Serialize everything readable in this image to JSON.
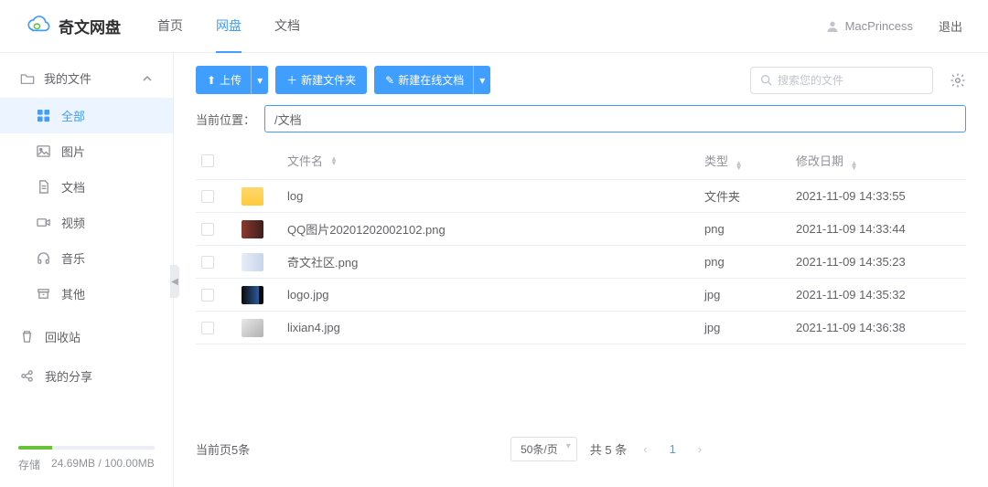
{
  "header": {
    "logo_text": "奇文网盘",
    "nav": [
      "首页",
      "网盘",
      "文档"
    ],
    "active_nav": 1,
    "username": "MacPrincess",
    "logout": "退出"
  },
  "sidebar": {
    "my_files_label": "我的文件",
    "items": [
      {
        "label": "全部",
        "icon": "grid",
        "active": true
      },
      {
        "label": "图片",
        "icon": "image",
        "active": false
      },
      {
        "label": "文档",
        "icon": "doc",
        "active": false
      },
      {
        "label": "视频",
        "icon": "video",
        "active": false
      },
      {
        "label": "音乐",
        "icon": "music",
        "active": false
      },
      {
        "label": "其他",
        "icon": "other",
        "active": false
      }
    ],
    "recycle_label": "回收站",
    "share_label": "我的分享",
    "storage_label": "存储",
    "storage_used": "24.69MB",
    "storage_total": "100.00MB"
  },
  "toolbar": {
    "upload": "上传",
    "new_folder": "新建文件夹",
    "new_doc": "新建在线文档",
    "search_placeholder": "搜索您的文件"
  },
  "path": {
    "label": "当前位置：",
    "value": "/文档"
  },
  "table": {
    "headers": {
      "name": "文件名",
      "type": "类型",
      "date": "修改日期"
    },
    "rows": [
      {
        "name": "log",
        "type": "文件夹",
        "date": "2021-11-09 14:33:55",
        "thumb": "folder"
      },
      {
        "name": "QQ图片20201202002102.png",
        "type": "png",
        "date": "2021-11-09 14:33:44",
        "thumb": "img1"
      },
      {
        "name": "奇文社区.png",
        "type": "png",
        "date": "2021-11-09 14:35:23",
        "thumb": "img2"
      },
      {
        "name": "logo.jpg",
        "type": "jpg",
        "date": "2021-11-09 14:35:32",
        "thumb": "img3"
      },
      {
        "name": "lixian4.jpg",
        "type": "jpg",
        "date": "2021-11-09 14:36:38",
        "thumb": "img4"
      }
    ]
  },
  "pager": {
    "summary": "当前页5条",
    "page_size": "50条/页",
    "total": "共 5 条",
    "current": "1"
  }
}
